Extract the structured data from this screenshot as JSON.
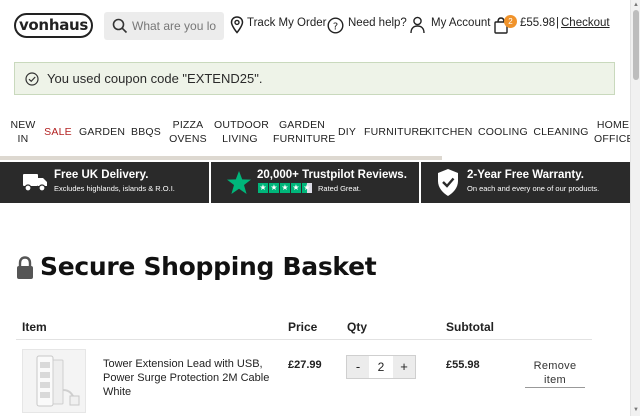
{
  "header": {
    "logo": "vonhaus",
    "search_placeholder": "What are you lo",
    "track_order": "Track My Order",
    "need_help": "Need help?",
    "my_account": "My Account",
    "cart_count": "2",
    "cart_total": "£55.98",
    "separator": "|",
    "checkout": "Checkout"
  },
  "coupon": {
    "message": "You used coupon code \"EXTEND25\"."
  },
  "nav": {
    "items": [
      {
        "line1": "NEW",
        "line2": "IN"
      },
      {
        "line1": "SALE",
        "line2": ""
      },
      {
        "line1": "GARDEN",
        "line2": ""
      },
      {
        "line1": "BBQS",
        "line2": ""
      },
      {
        "line1": "PIZZA",
        "line2": "OVENS"
      },
      {
        "line1": "OUTDOOR",
        "line2": "LIVING"
      },
      {
        "line1": "GARDEN",
        "line2": "FURNITURE"
      },
      {
        "line1": "DIY",
        "line2": ""
      },
      {
        "line1": "FURNITURE",
        "line2": ""
      },
      {
        "line1": "KITCHEN",
        "line2": ""
      },
      {
        "line1": "COOLING",
        "line2": ""
      },
      {
        "line1": "CLEANING",
        "line2": ""
      },
      {
        "line1": "HOME",
        "line2": "OFFICE"
      }
    ]
  },
  "promo": {
    "delivery_title": "Free UK Delivery.",
    "delivery_sub": "Excludes highlands, islands & R.O.I.",
    "reviews_title": "20,000+ Trustpilot Reviews.",
    "reviews_sub": "Rated Great.",
    "rating_stars": 4.5,
    "warranty_title": "2-Year Free Warranty.",
    "warranty_sub": "On each and every one of our products.",
    "accent_color": "#00b67a"
  },
  "basket": {
    "title": "Secure Shopping Basket",
    "columns": {
      "item": "Item",
      "price": "Price",
      "qty": "Qty",
      "subtotal": "Subtotal"
    },
    "rows": [
      {
        "name": "Tower Extension Lead with USB, Power Surge Protection 2M Cable White",
        "price": "£27.99",
        "qty": "2",
        "minus": "-",
        "plus": "+",
        "subtotal": "£55.98",
        "remove": "Remove item"
      }
    ]
  },
  "colors": {
    "badge": "#f0932b",
    "sale": "#b32222",
    "promo_bg": "#2a2a2a",
    "coupon_bg": "#eef3e8"
  }
}
